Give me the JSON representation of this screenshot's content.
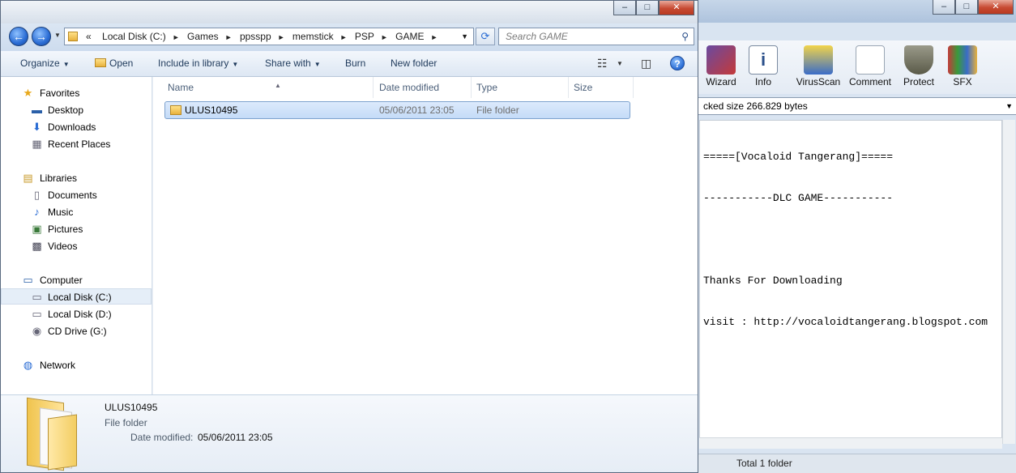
{
  "explorer": {
    "address": {
      "overflow_label": "«",
      "crumbs": [
        "Local Disk (C:)",
        "Games",
        "ppsspp",
        "memstick",
        "PSP",
        "GAME"
      ]
    },
    "search_placeholder": "Search GAME",
    "toolbar": {
      "organize": "Organize",
      "open": "Open",
      "include_in_library": "Include in library",
      "share_with": "Share with",
      "burn": "Burn",
      "new_folder": "New folder"
    },
    "nav": {
      "favorites": "Favorites",
      "desktop": "Desktop",
      "downloads": "Downloads",
      "recent_places": "Recent Places",
      "libraries": "Libraries",
      "documents": "Documents",
      "music": "Music",
      "pictures": "Pictures",
      "videos": "Videos",
      "computer": "Computer",
      "local_disk_c": "Local Disk (C:)",
      "local_disk_d": "Local Disk (D:)",
      "cd_drive_g": "CD Drive (G:)",
      "network": "Network"
    },
    "columns": {
      "name": "Name",
      "date_modified": "Date modified",
      "type": "Type",
      "size": "Size"
    },
    "files": [
      {
        "name": "ULUS10495",
        "date_modified": "05/06/2011 23:05",
        "type": "File folder",
        "size": ""
      }
    ],
    "details": {
      "name": "ULUS10495",
      "type": "File folder",
      "date_modified_label": "Date modified:",
      "date_modified_value": "05/06/2011 23:05"
    }
  },
  "winrar": {
    "tools": {
      "wizard": "Wizard",
      "info": "Info",
      "virusscan": "VirusScan",
      "comment": "Comment",
      "protect": "Protect",
      "sfx": "SFX"
    },
    "path_text": "cked size 266.829 bytes",
    "comment_lines": [
      "=====[Vocaloid Tangerang]=====",
      "-----------DLC GAME-----------",
      "",
      "Thanks For Downloading",
      "visit : http://vocaloidtangerang.blogspot.com"
    ],
    "status": "Total 1 folder"
  },
  "colors": {
    "accent": "#2a6cd4",
    "selection": "#c4dbf7",
    "toolbar_text": "#1e395b"
  }
}
